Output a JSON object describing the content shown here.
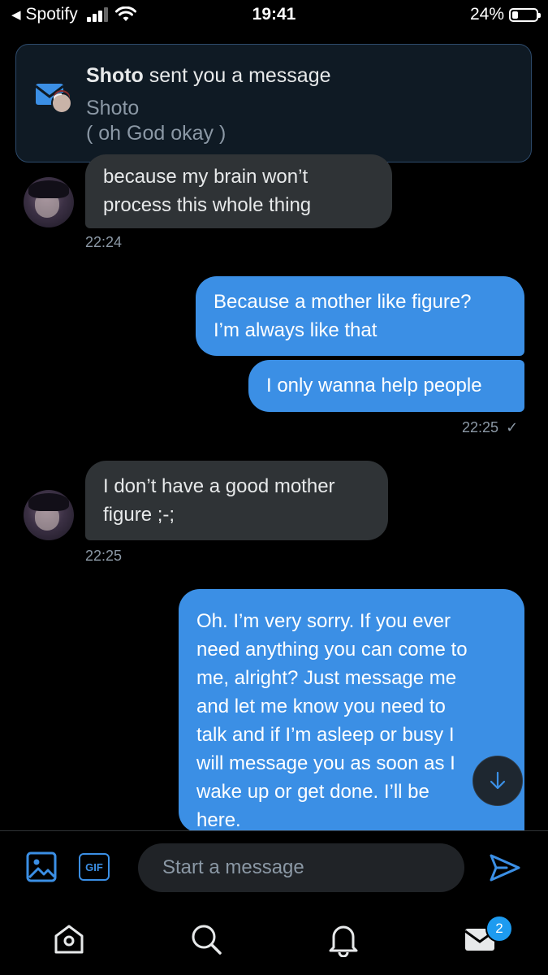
{
  "status_bar": {
    "back_app": "Spotify",
    "time": "19:41",
    "battery_percent": "24%",
    "battery_level": 0.24
  },
  "notification": {
    "sender_bold": "Shoto",
    "title_rest": " sent you a message",
    "sender_name": "Shoto",
    "preview": "( oh God okay )"
  },
  "messages": [
    {
      "dir": "in",
      "lines": [
        "because my brain won’t",
        "process this whole thing"
      ]
    },
    {
      "dir": "in_ts",
      "time": "22:24"
    },
    {
      "dir": "out",
      "lines": [
        "Because a mother like figure?",
        "I’m always like that"
      ]
    },
    {
      "dir": "out",
      "lines": [
        "I only wanna help people"
      ]
    },
    {
      "dir": "out_ts",
      "time": "22:25"
    },
    {
      "dir": "in",
      "lines": [
        "I don’t have a good mother",
        "figure ;-;"
      ]
    },
    {
      "dir": "in_ts",
      "time": "22:25"
    },
    {
      "dir": "out",
      "lines": [
        "Oh. I’m very sorry. If you ever",
        "need anything you can come to",
        "me, alright? Just message me",
        "and let me know you need to",
        "talk and if I’m asleep or busy I",
        "will message you as soon as I",
        "wake up or get done. I’ll be",
        "here."
      ]
    }
  ],
  "composer": {
    "gif_label": "GIF",
    "placeholder": "Start a message"
  },
  "tabbar": {
    "messages_badge": "2"
  },
  "colors": {
    "accent": "#3b8fe5",
    "incoming_bubble": "#2f3336",
    "background": "#000000"
  },
  "icons": [
    "back-arrow-icon",
    "signal-icon",
    "wifi-icon",
    "battery-icon",
    "mail-notification-icon",
    "read-check-icon",
    "arrow-down-icon",
    "image-icon",
    "gif-icon",
    "send-icon",
    "home-icon",
    "search-icon",
    "bell-icon",
    "mail-icon"
  ]
}
